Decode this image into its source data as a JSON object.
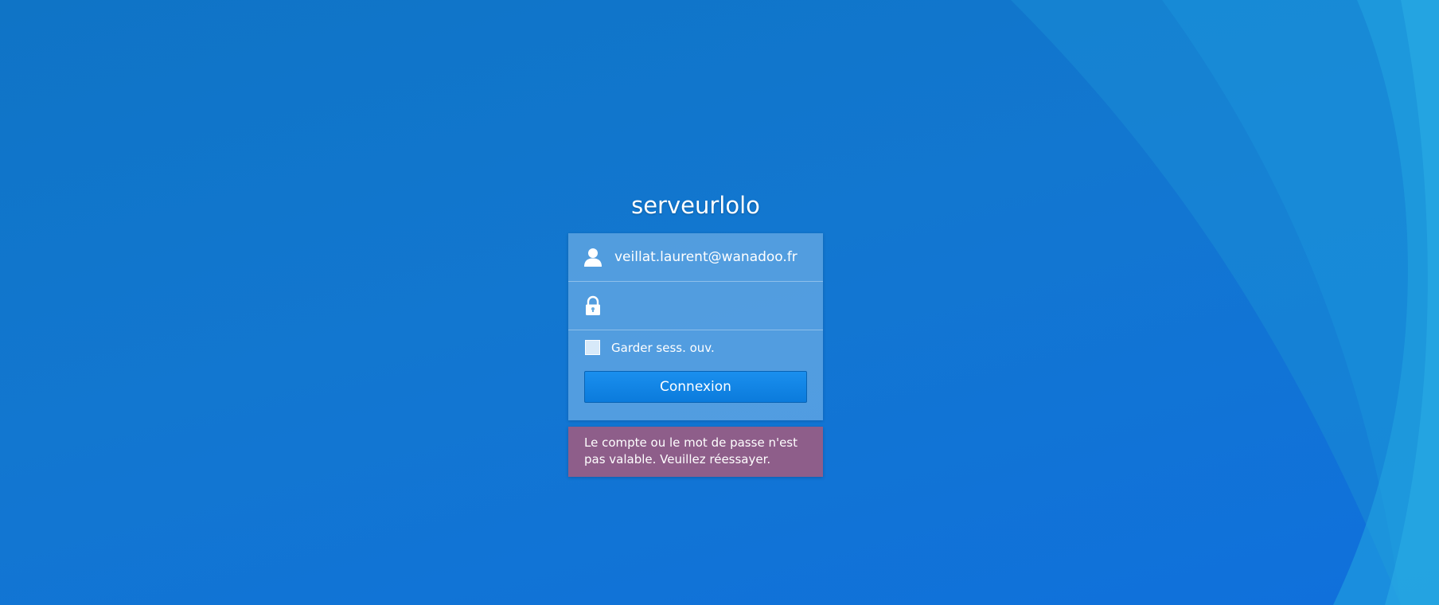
{
  "background": {
    "base_color": "#1277d0",
    "accent_color": "#1a9ad8"
  },
  "login": {
    "server_name": "serveurlolo",
    "username_icon": "user-icon",
    "username_value": "veillat.laurent@wanadoo.fr",
    "password_icon": "lock-icon",
    "password_value": "",
    "remember_checked": false,
    "remember_label": "Garder sess. ouv.",
    "submit_label": "Connexion",
    "button_color": "#1486e6",
    "error_message": "Le compte ou le mot de passe n'est pas valable. Veuillez réessayer.",
    "error_color": "#8e5e8a"
  }
}
